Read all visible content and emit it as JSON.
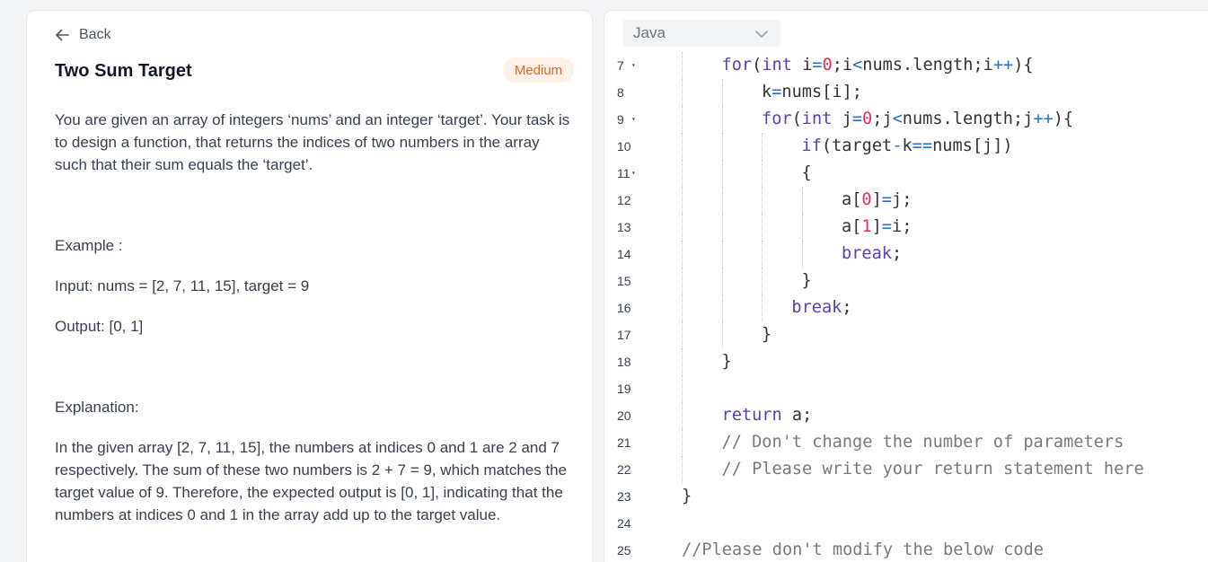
{
  "problem": {
    "back_label": "Back",
    "title": "Two Sum Target",
    "difficulty": "Medium",
    "description": "You are given an array of integers ‘nums’ and an integer ‘target’. Your task is to design a function, that returns the indices of two numbers in the array such that their sum equals the ‘target’.",
    "example_label": "Example :",
    "example_input": "Input: nums = [2, 7, 11, 15], target = 9",
    "example_output": "Output: [0, 1]",
    "explanation_label": "Explanation:",
    "explanation": "In the given array [2, 7, 11, 15], the numbers at indices 0 and 1 are 2 and 7 respectively. The sum of these two numbers is 2 + 7 = 9, which matches the target value of 9. Therefore, the expected output is [0, 1], indicating that the numbers at indices 0 and 1 in the array add up to the target value."
  },
  "editor": {
    "language": "Java",
    "lines": [
      {
        "n": "7",
        "fold": true,
        "indent": 1,
        "tokens": [
          [
            "kw",
            "for"
          ],
          [
            "p",
            "("
          ],
          [
            "kw",
            "int"
          ],
          [
            "p",
            " i"
          ],
          [
            "op",
            "="
          ],
          [
            "num",
            "0"
          ],
          [
            "p",
            ";i"
          ],
          [
            "op",
            "<"
          ],
          [
            "p",
            "nums.length;i"
          ],
          [
            "op",
            "++"
          ],
          [
            "p",
            "){"
          ]
        ]
      },
      {
        "n": "8",
        "fold": false,
        "indent": 2,
        "tokens": [
          [
            "p",
            "k"
          ],
          [
            "op",
            "="
          ],
          [
            "p",
            "nums[i];"
          ]
        ]
      },
      {
        "n": "9",
        "fold": true,
        "indent": 2,
        "tokens": [
          [
            "kw",
            "for"
          ],
          [
            "p",
            "("
          ],
          [
            "kw",
            "int"
          ],
          [
            "p",
            " j"
          ],
          [
            "op",
            "="
          ],
          [
            "num",
            "0"
          ],
          [
            "p",
            ";j"
          ],
          [
            "op",
            "<"
          ],
          [
            "p",
            "nums.length;j"
          ],
          [
            "op",
            "++"
          ],
          [
            "p",
            "){"
          ]
        ]
      },
      {
        "n": "10",
        "fold": false,
        "indent": 3,
        "tokens": [
          [
            "kw",
            "if"
          ],
          [
            "p",
            "(target"
          ],
          [
            "op",
            "-"
          ],
          [
            "p",
            "k"
          ],
          [
            "op",
            "=="
          ],
          [
            "p",
            "nums[j])"
          ]
        ]
      },
      {
        "n": "11",
        "fold": true,
        "indent": 3,
        "tokens": [
          [
            "p",
            "{"
          ]
        ]
      },
      {
        "n": "12",
        "fold": false,
        "indent": 4,
        "tokens": [
          [
            "p",
            "a["
          ],
          [
            "num",
            "0"
          ],
          [
            "p",
            "]"
          ],
          [
            "op",
            "="
          ],
          [
            "p",
            "j;"
          ]
        ]
      },
      {
        "n": "13",
        "fold": false,
        "indent": 4,
        "tokens": [
          [
            "p",
            "a["
          ],
          [
            "num",
            "1"
          ],
          [
            "p",
            "]"
          ],
          [
            "op",
            "="
          ],
          [
            "p",
            "i;"
          ]
        ]
      },
      {
        "n": "14",
        "fold": false,
        "indent": 4,
        "tokens": [
          [
            "kw",
            "break"
          ],
          [
            "p",
            ";"
          ]
        ]
      },
      {
        "n": "15",
        "fold": false,
        "indent": 3,
        "tokens": [
          [
            "p",
            "}"
          ]
        ]
      },
      {
        "n": "16",
        "fold": false,
        "indent": 2.75,
        "tokens": [
          [
            "kw",
            "break"
          ],
          [
            "p",
            ";"
          ]
        ]
      },
      {
        "n": "17",
        "fold": false,
        "indent": 2,
        "tokens": [
          [
            "p",
            "}"
          ]
        ]
      },
      {
        "n": "18",
        "fold": false,
        "indent": 1,
        "tokens": [
          [
            "p",
            "}"
          ]
        ]
      },
      {
        "n": "19",
        "fold": false,
        "indent": 1,
        "tokens": []
      },
      {
        "n": "20",
        "fold": false,
        "indent": 1,
        "tokens": [
          [
            "kw",
            "return"
          ],
          [
            "p",
            " a;"
          ]
        ]
      },
      {
        "n": "21",
        "fold": false,
        "indent": 1,
        "tokens": [
          [
            "cm",
            "// Don't change the number of parameters"
          ]
        ]
      },
      {
        "n": "22",
        "fold": false,
        "indent": 1,
        "tokens": [
          [
            "cm",
            "// Please write your return statement here"
          ]
        ]
      },
      {
        "n": "23",
        "fold": false,
        "indent": 0,
        "tokens": [
          [
            "p",
            "}"
          ]
        ]
      },
      {
        "n": "24",
        "fold": false,
        "indent": 0,
        "tokens": []
      },
      {
        "n": "25",
        "fold": false,
        "indent": 0,
        "tokens": [
          [
            "cm",
            "//Please don't modify the below code"
          ]
        ]
      }
    ]
  },
  "icons": {
    "back": "arrow-left-icon",
    "dropdown": "chevron-down-icon",
    "fold": "fold-arrow-icon"
  },
  "colors": {
    "keyword": "#5b3fb4",
    "number": "#e0315f",
    "operator": "#2a6ed1",
    "comment": "#7a7a7a",
    "difficulty_text": "#e0691f",
    "difficulty_bg": "#fdf1ea"
  }
}
